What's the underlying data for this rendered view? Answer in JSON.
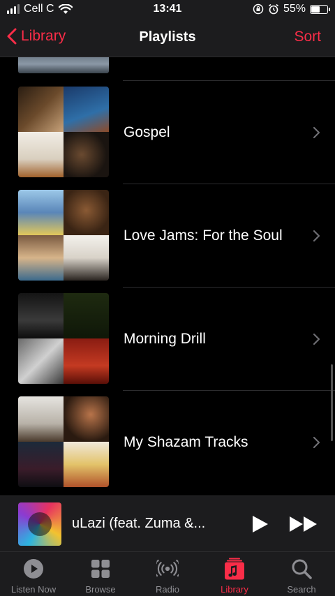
{
  "status_bar": {
    "carrier": "Cell C",
    "time": "13:41",
    "battery": "55%",
    "battery_level": 0.55
  },
  "nav": {
    "back_label": "Library",
    "title": "Playlists",
    "sort_label": "Sort"
  },
  "playlists": [
    {
      "title": "Gospel"
    },
    {
      "title": "Love Jams: For the Soul"
    },
    {
      "title": "Morning Drill"
    },
    {
      "title": "My Shazam Tracks"
    }
  ],
  "now_playing": {
    "title": "uLazi (feat. Zuma &..."
  },
  "tabs": [
    {
      "label": "Listen Now",
      "icon": "play-circle-icon"
    },
    {
      "label": "Browse",
      "icon": "grid-icon"
    },
    {
      "label": "Radio",
      "icon": "radio-waves-icon"
    },
    {
      "label": "Library",
      "icon": "music-library-icon"
    },
    {
      "label": "Search",
      "icon": "search-icon"
    }
  ],
  "colors": {
    "accent": "#fa2d48",
    "background": "#000000",
    "bar_background": "#1c1c1e",
    "inactive_tab": "#8e8e93"
  }
}
